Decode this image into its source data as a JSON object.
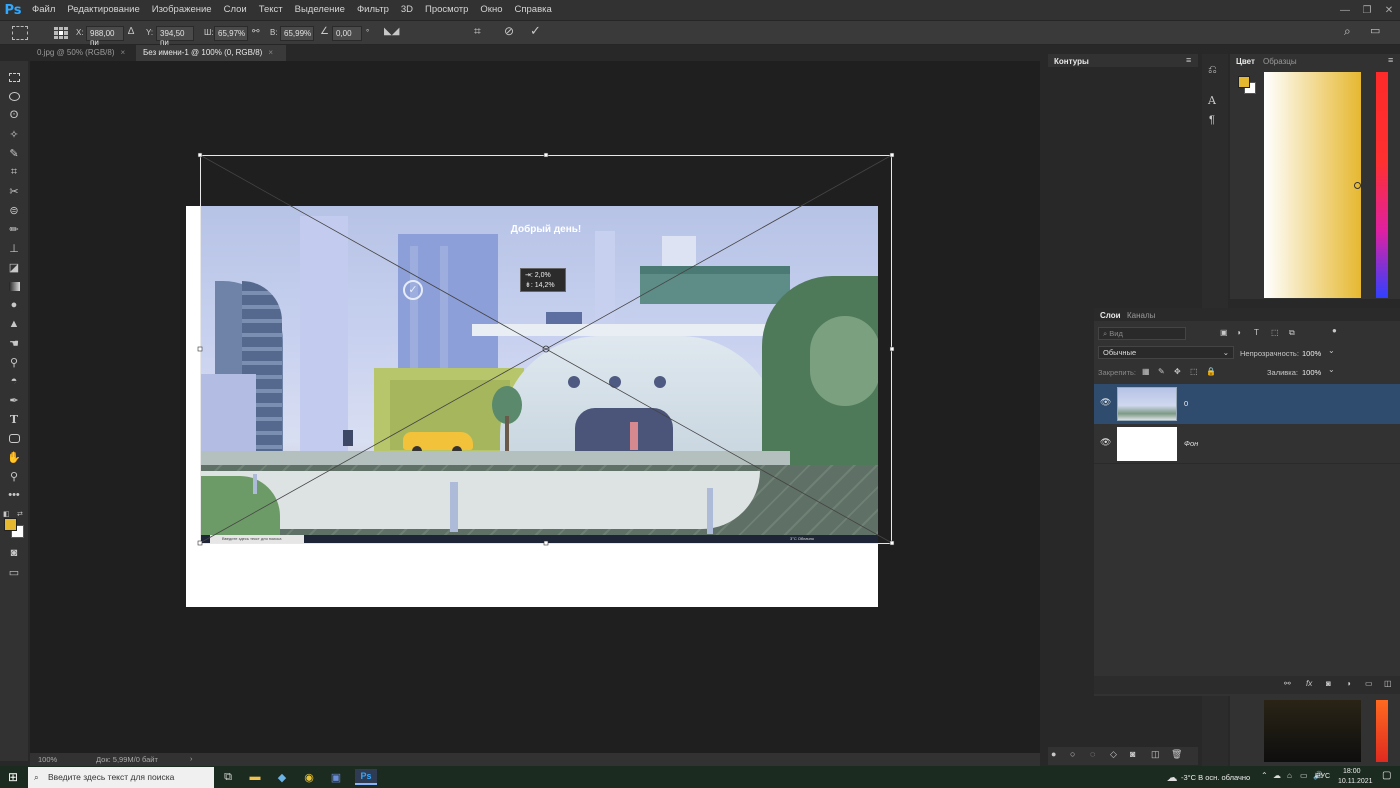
{
  "app": {
    "logo": "Ps"
  },
  "menu": [
    "Файл",
    "Редактирование",
    "Изображение",
    "Слои",
    "Текст",
    "Выделение",
    "Фильтр",
    "3D",
    "Просмотр",
    "Окно",
    "Справка"
  ],
  "window_controls": {
    "minimize": "—",
    "restore": "❐",
    "close": "✕"
  },
  "options": {
    "x_label": "X:",
    "x_value": "988,00 пи",
    "y_label": "Y:",
    "y_value": "394,50 пи",
    "w_label": "Ш:",
    "w_value": "65,97%",
    "h_label": "В:",
    "h_value": "65,99%",
    "angle_value": "0,00",
    "angle_unit": "°"
  },
  "tabs": [
    {
      "label": "0.jpg @ 50% (RGB/8)",
      "close": "×"
    },
    {
      "label": "Без имени-1 @ 100% (0, RGB/8)",
      "close": "×"
    }
  ],
  "canvas": {
    "greeting": "Добрый день!",
    "transform_info_line1": "⇥: 2,0%",
    "transform_info_line2": "⇟: 14,2%",
    "inner_taskbar_search": "Введите здесь текст для поиска",
    "inner_weather": "3°C Облачно"
  },
  "status": {
    "zoom": "100%",
    "doc": "Док: 5,99М/0 байт",
    "arrow": "›"
  },
  "panels": {
    "paths_tab": "Контуры",
    "color_tab": "Цвет",
    "swatches_tab": "Образцы",
    "layers_tab": "Слои",
    "channels_tab": "Каналы",
    "kind_placeholder": "Вид",
    "blend_mode": "Обычные",
    "opacity_label": "Непрозрачность:",
    "opacity_value": "100%",
    "lock_label": "Закрепить:",
    "fill_label": "Заливка:",
    "fill_value": "100%",
    "layers": [
      {
        "name": "0",
        "selected": true
      },
      {
        "name": "Фон",
        "selected": false
      }
    ]
  },
  "taskbar": {
    "search_placeholder": "Введите здесь текст для поиска",
    "weather": "-3°C В осн. облачно",
    "lang": "РУС",
    "time": "18:00",
    "date": "10.11.2021"
  },
  "colors": {
    "foreground": "#e6b830",
    "background": "#ffffff",
    "accent": "#31a8ff",
    "selected_layer": "#2f4c6e"
  }
}
